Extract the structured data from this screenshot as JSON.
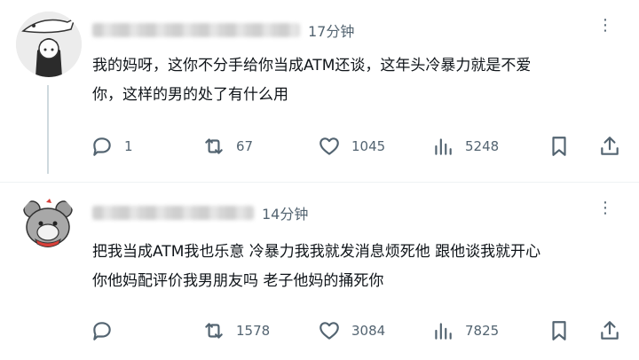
{
  "posts": [
    {
      "time": "17分钟",
      "more": "⋮",
      "lines": [
        "我的妈呀，这你不分手给你当成ATM还谈，这年头冷暴力就是不爱",
        "你，这样的男的处了有什么用"
      ],
      "stats": {
        "replies": "1",
        "reposts": "67",
        "likes": "1045",
        "views": "5248"
      }
    },
    {
      "time": "14分钟",
      "more": "⋮",
      "lines": [
        "把我当成ATM我也乐意 冷暴力我我就发消息烦死他 跟他谈我就开心",
        "你他妈配评价我男朋友吗 老子他妈的捅死你"
      ],
      "stats": {
        "replies": "",
        "reposts": "1578",
        "likes": "3084",
        "views": "7825"
      }
    }
  ],
  "icons": [
    "reply-icon",
    "repost-icon",
    "like-icon",
    "views-icon",
    "bookmark-icon",
    "share-icon"
  ]
}
